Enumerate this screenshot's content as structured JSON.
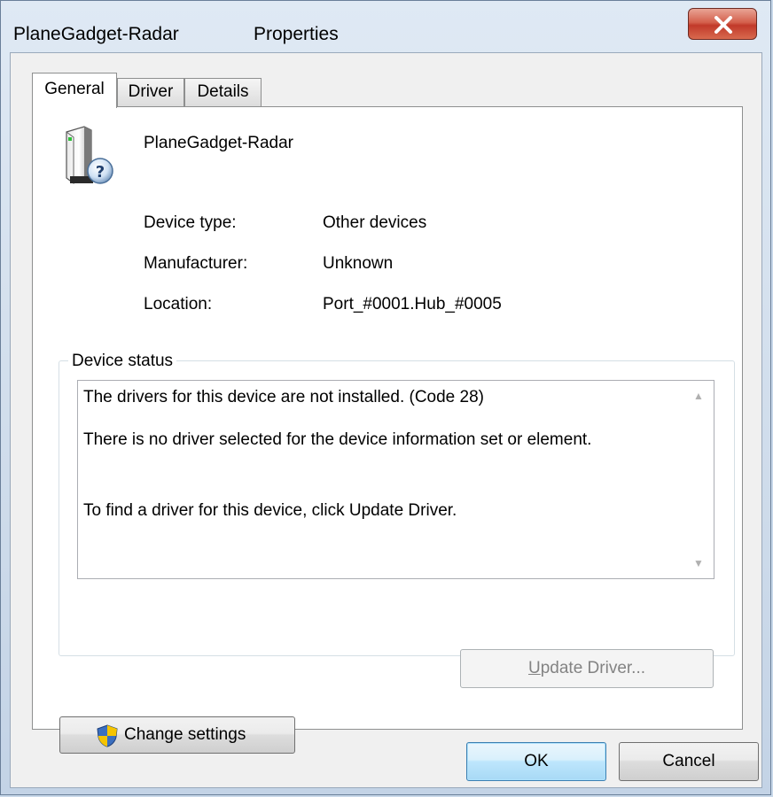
{
  "window": {
    "title_name": "PlaneGadget-Radar",
    "title_suffix": "Properties",
    "close_label": "X"
  },
  "tabs": [
    {
      "label": "General",
      "active": true
    },
    {
      "label": "Driver",
      "active": false
    },
    {
      "label": "Details",
      "active": false
    }
  ],
  "device": {
    "name": "PlaneGadget-Radar",
    "icon": "unknown-device-icon",
    "properties": [
      {
        "label": "Device type:",
        "value": "Other devices"
      },
      {
        "label": "Manufacturer:",
        "value": "Unknown"
      },
      {
        "label": "Location:",
        "value": "Port_#0001.Hub_#0005"
      }
    ]
  },
  "status": {
    "legend": "Device status",
    "lines": [
      "The drivers for this device are not installed. (Code 28)",
      "There is no driver selected for the device information set or element.",
      "To find a driver for this device, click Update Driver."
    ]
  },
  "buttons": {
    "update_driver_accel": "U",
    "update_driver_rest": "pdate Driver...",
    "change_settings": "Change settings",
    "ok": "OK",
    "cancel": "Cancel"
  }
}
